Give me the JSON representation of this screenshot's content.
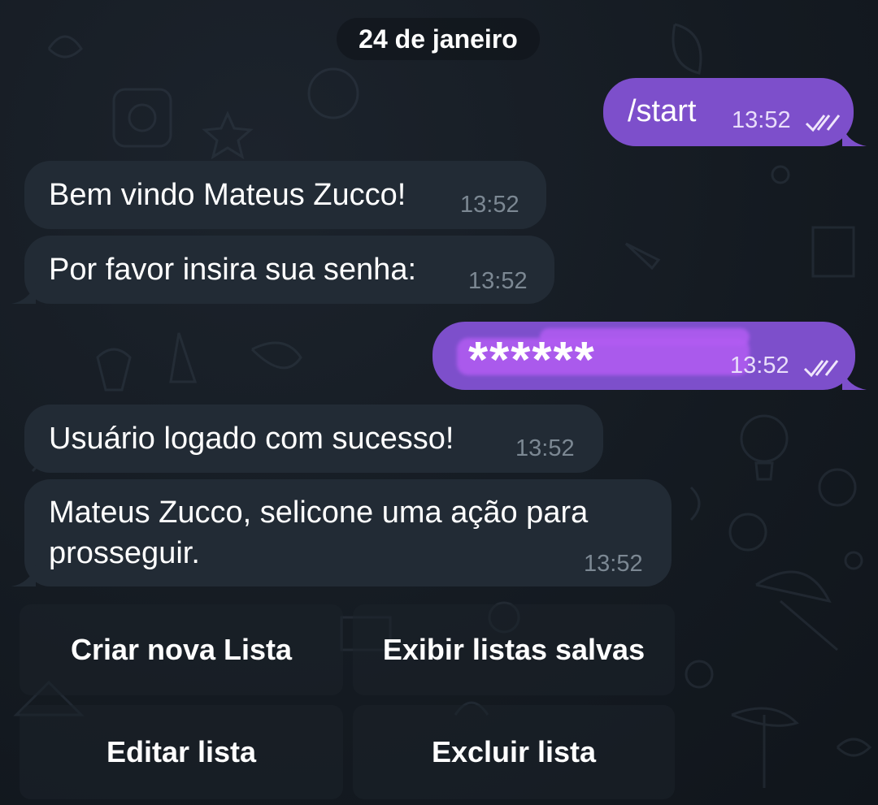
{
  "date_separator": "24 de janeiro",
  "messages": [
    {
      "direction": "out",
      "text": "/start",
      "time": "13:52",
      "status_icon": "double-check-icon"
    },
    {
      "direction": "in",
      "text": "Bem vindo Mateus Zucco!",
      "time": "13:52"
    },
    {
      "direction": "in",
      "text": "Por favor insira sua senha:",
      "time": "13:52"
    },
    {
      "direction": "out",
      "text": "******",
      "time": "13:52",
      "status_icon": "double-check-icon"
    },
    {
      "direction": "in",
      "text": "Usuário logado com sucesso!",
      "time": "13:52"
    },
    {
      "direction": "in",
      "text_line1": "Mateus Zucco, selicone uma ação para",
      "text_line2": "prosseguir.",
      "time": "13:52"
    }
  ],
  "keyboard": {
    "buttons": [
      {
        "label": "Criar nova Lista"
      },
      {
        "label": "Exibir listas salvas"
      },
      {
        "label": "Editar lista"
      },
      {
        "label": "Excluir lista"
      }
    ]
  },
  "colors": {
    "background": "#151b23",
    "incoming_bubble": "#222b35",
    "outgoing_bubble": "#7d4fcb",
    "timestamp_incoming": "#7c8893",
    "highlight_mark": "#b25cf2"
  }
}
